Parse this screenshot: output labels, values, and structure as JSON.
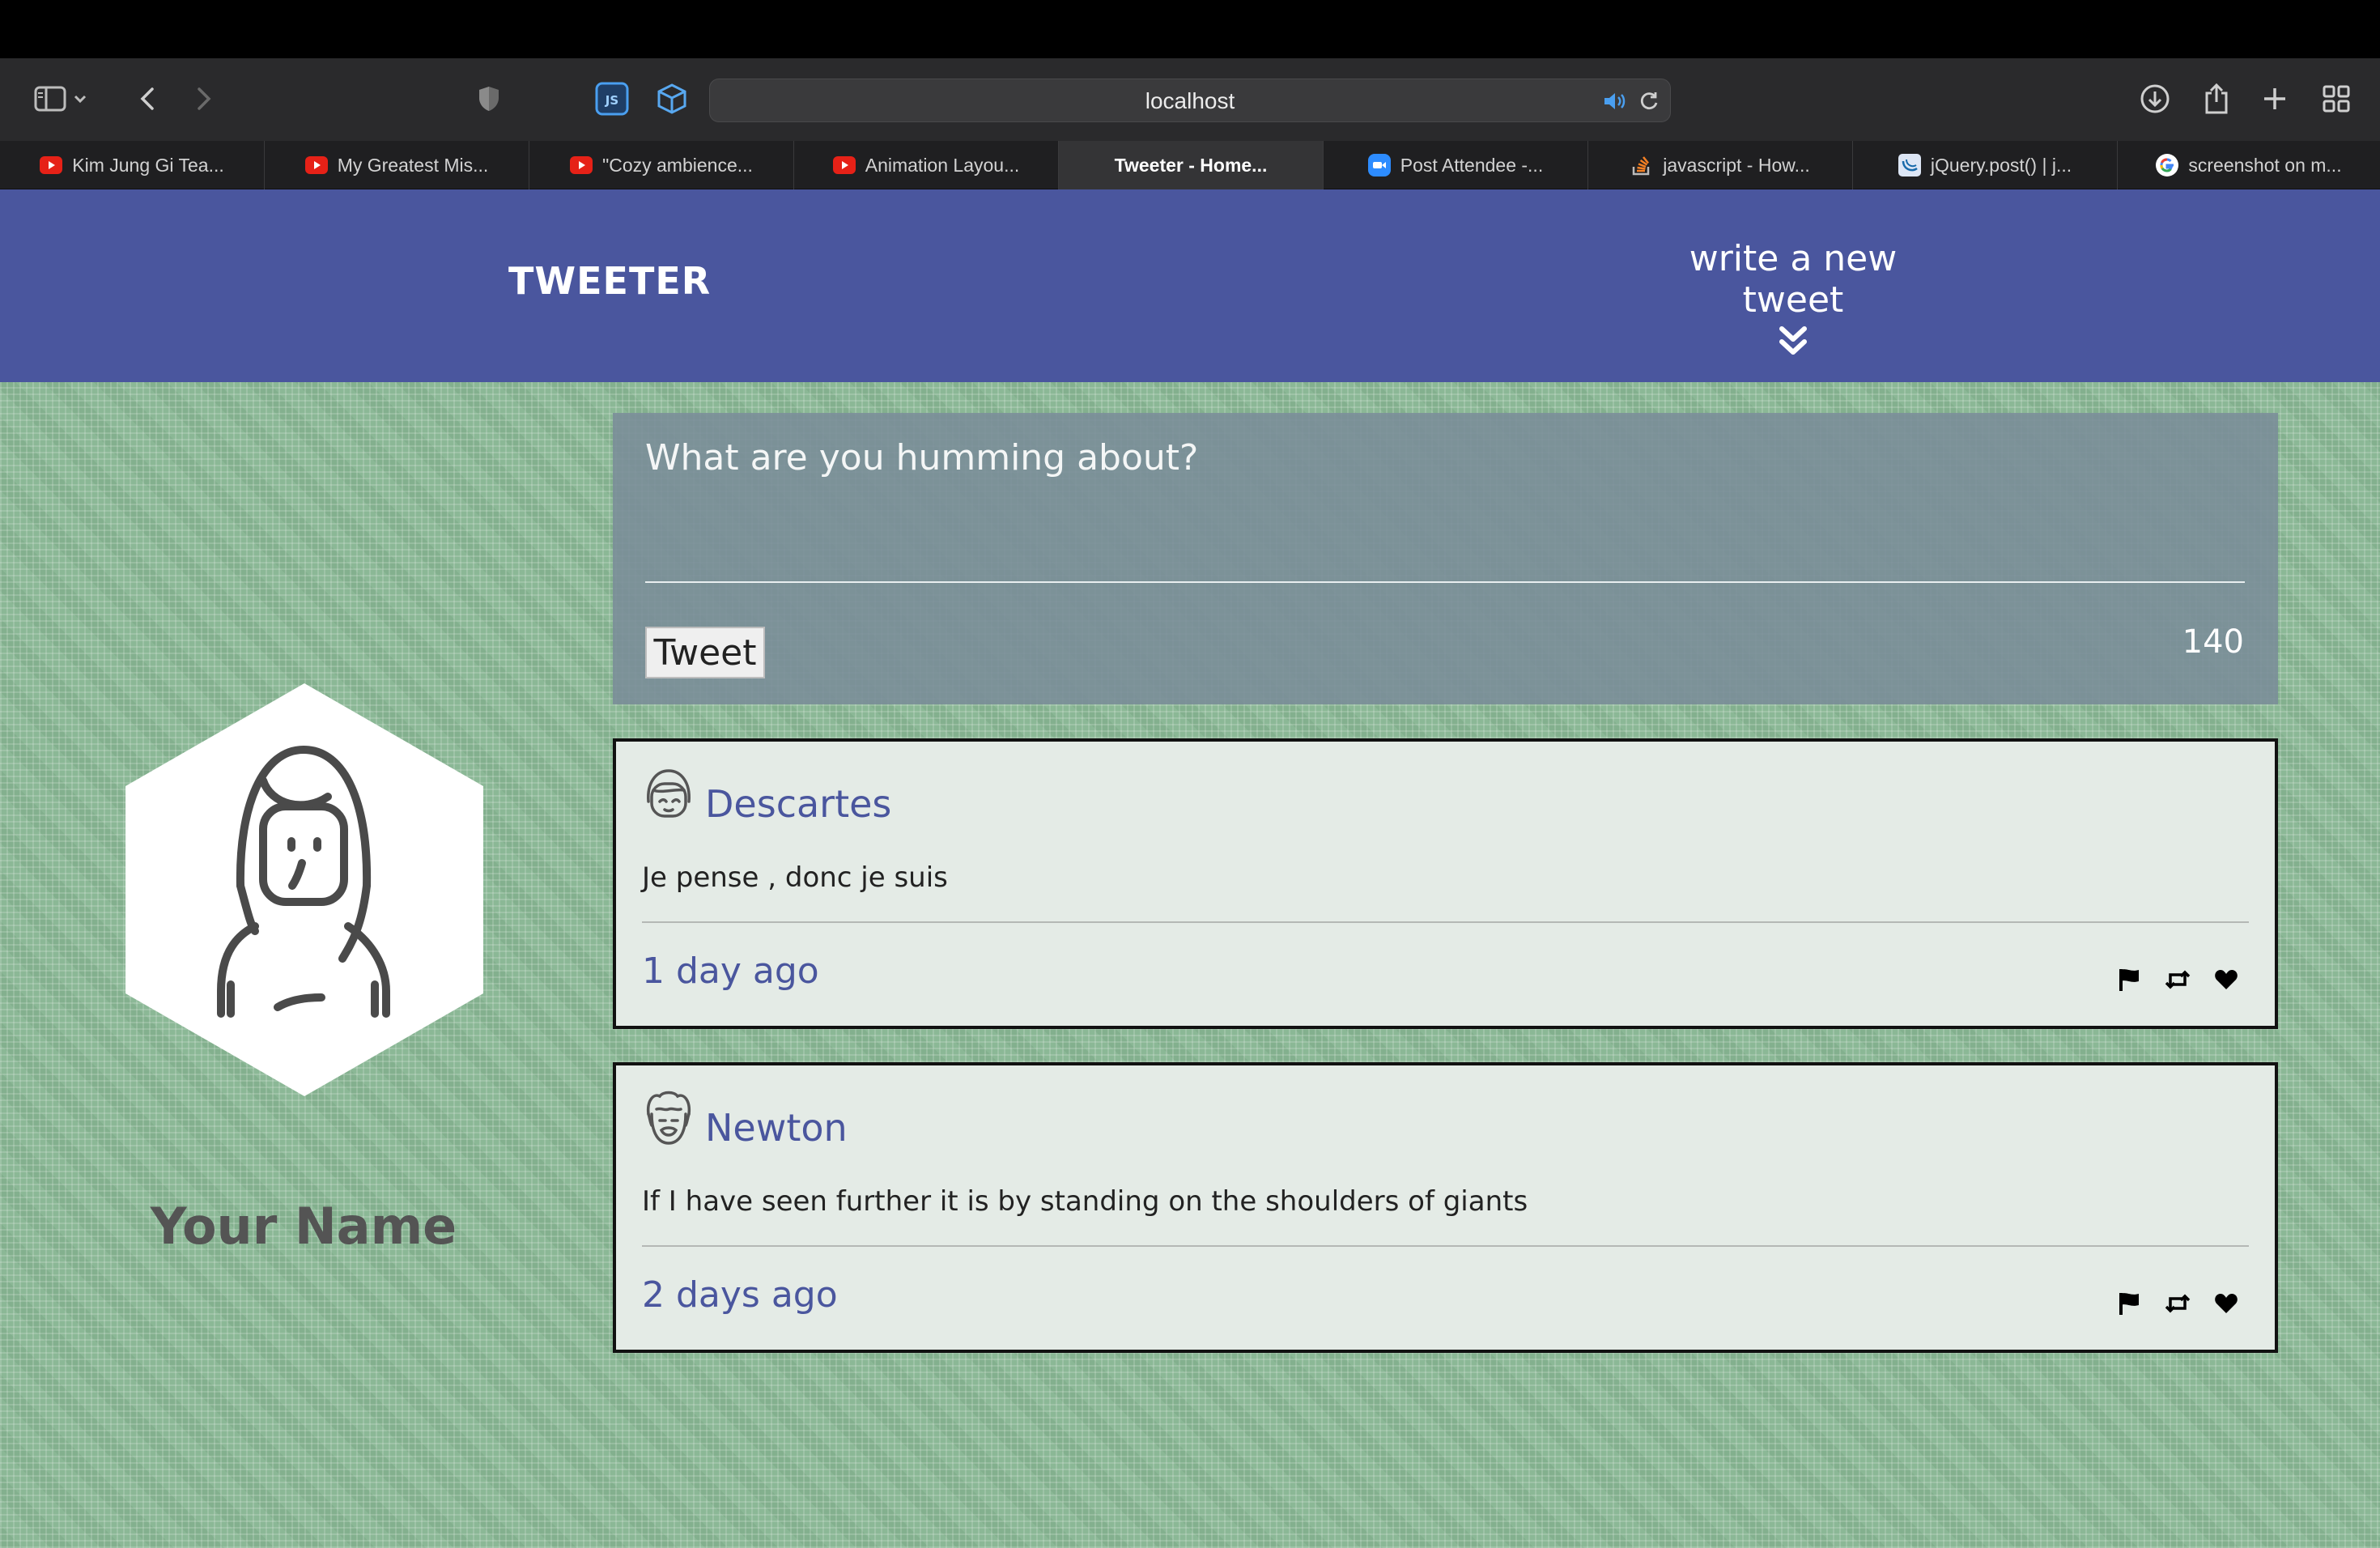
{
  "browser": {
    "url": "localhost",
    "tabs": [
      {
        "label": "Kim Jung Gi Tea...",
        "favicon": "youtube-icon"
      },
      {
        "label": "My Greatest Mis...",
        "favicon": "youtube-icon"
      },
      {
        "label": "\"Cozy ambience...",
        "favicon": "youtube-icon"
      },
      {
        "label": "Animation Layou...",
        "favicon": "youtube-icon"
      },
      {
        "label": "Tweeter - Home...",
        "favicon": "none",
        "active": true
      },
      {
        "label": "Post Attendee -...",
        "favicon": "zoom-icon"
      },
      {
        "label": "javascript - How...",
        "favicon": "stackoverflow-icon"
      },
      {
        "label": "jQuery.post() | j...",
        "favicon": "jquery-icon"
      },
      {
        "label": "screenshot on m...",
        "favicon": "google-icon"
      }
    ]
  },
  "nav": {
    "brand": "TWEETER",
    "compose_label": "write a new tweet"
  },
  "composer": {
    "placeholder": "What are you humming about?",
    "button_label": "Tweet",
    "counter": "140"
  },
  "profile": {
    "name": "Your Name"
  },
  "tweets": [
    {
      "name": "Descartes",
      "text": "Je pense , donc je suis",
      "time": "1 day ago"
    },
    {
      "name": "Newton",
      "text": "If I have seen further it is by standing on the shoulders of giants",
      "time": "2 days ago"
    }
  ],
  "colors": {
    "nav_bg": "#4a569e",
    "accent": "#4a569e",
    "page_bg": "#8bb896",
    "composer_bg": "#7a8c98"
  }
}
